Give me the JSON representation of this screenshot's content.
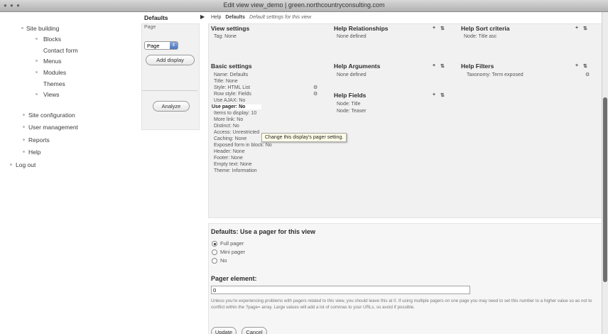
{
  "window": {
    "title": "Edit view view_demo | green.northcountryconsulting.com"
  },
  "sidebar": {
    "items": [
      {
        "label": "Site building"
      },
      {
        "label": "Blocks"
      },
      {
        "label": "Contact form"
      },
      {
        "label": "Menus"
      },
      {
        "label": "Modules"
      },
      {
        "label": "Themes"
      },
      {
        "label": "Views"
      },
      {
        "label": "Site configuration"
      },
      {
        "label": "User management"
      },
      {
        "label": "Reports"
      },
      {
        "label": "Help"
      },
      {
        "label": "Log out"
      }
    ]
  },
  "displays": {
    "title": "Defaults",
    "sub": "Page",
    "select_value": "Page",
    "add_display": "Add display",
    "analyze": "Analyze"
  },
  "breadcrumb": {
    "help": "Help",
    "section": "Defaults",
    "desc": "Default settings for this view"
  },
  "view_settings": {
    "title": "View settings",
    "lines": [
      "Tag: None"
    ]
  },
  "basic_settings": {
    "title": "Basic settings",
    "lines": [
      "Name: Defaults",
      "Title: None",
      "Style: HTML List",
      "Row style: Fields",
      "Use AJAX: No",
      "Use pager: No",
      "Items to display: 10",
      "More link: No",
      "Distinct: No",
      "Access: Unrestricted",
      "Caching: None",
      "Exposed form in block: No",
      "Header: None",
      "Footer: None",
      "Empty text: None",
      "Theme: Information"
    ]
  },
  "relationships": {
    "title": "Relationships",
    "help": "Help",
    "value": "None defined"
  },
  "arguments": {
    "title": "Arguments",
    "help": "Help",
    "value": "None defined"
  },
  "fields": {
    "title": "Fields",
    "help": "Help",
    "values": [
      "Node: Title",
      "Node: Teaser"
    ]
  },
  "sort": {
    "title": "Sort criteria",
    "help": "Help",
    "value": "Node: Title asc"
  },
  "filters": {
    "title": "Filters",
    "help": "Help",
    "value": "Taxonomy: Term exposed"
  },
  "tooltip": "Change this display's pager setting.",
  "pager_form": {
    "title": "Defaults: Use a pager for this view",
    "options": [
      "Full pager",
      "Mini pager",
      "No"
    ],
    "selected": "Full pager",
    "element_label": "Pager element:",
    "element_value": "0",
    "help_text": "Unless you're experiencing problems with pagers related to this view, you should leave this at 0. If using multiple pagers on one page you may need to set this number to a higher value so as not to conflict within the ?page= array. Large values will add a lot of commas to your URLs, so avoid if possible.",
    "update": "Update",
    "cancel": "Cancel"
  },
  "icons": {
    "plus": "+",
    "rearrange": "⇅",
    "gear": "⚙"
  },
  "colors": {
    "panel": "#f1f1f1",
    "scroll_thumb": "#6f6f6f"
  }
}
